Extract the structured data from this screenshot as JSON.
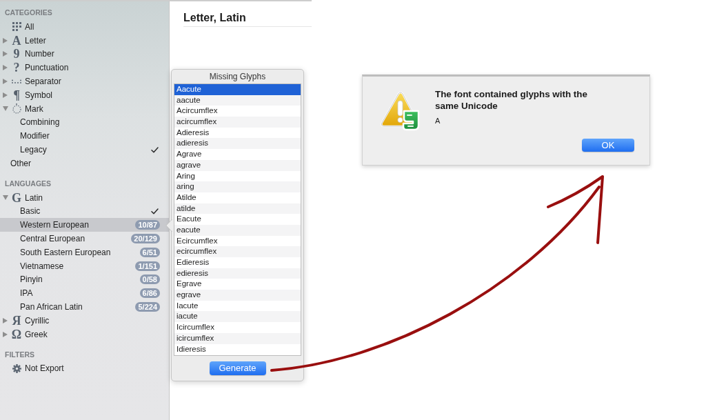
{
  "sidebar": {
    "sections": [
      {
        "title": "CATEGORIES",
        "items": [
          {
            "label": "All",
            "selected": false,
            "checked": false
          },
          {
            "label": "Letter",
            "glyph": "A",
            "expanded": false,
            "selected": false,
            "checked": false
          },
          {
            "label": "Number",
            "glyph": "9",
            "expanded": false,
            "selected": false,
            "checked": false
          },
          {
            "label": "Punctuation",
            "glyph": "?",
            "expanded": false,
            "selected": false,
            "checked": false
          },
          {
            "label": "Separator",
            "expanded": false,
            "selected": false,
            "checked": false
          },
          {
            "label": "Symbol",
            "glyph": "¶",
            "expanded": false,
            "selected": false,
            "checked": false
          },
          {
            "label": "Mark",
            "expanded": true,
            "selected": false,
            "checked": false,
            "children": [
              {
                "label": "Combining",
                "selected": false,
                "checked": false
              },
              {
                "label": "Modifier",
                "selected": false,
                "checked": false
              },
              {
                "label": "Legacy",
                "selected": false,
                "checked": true
              }
            ]
          },
          {
            "label": "Other",
            "selected": false,
            "checked": false
          }
        ]
      },
      {
        "title": "LANGUAGES",
        "items": [
          {
            "label": "Latin",
            "glyph": "G",
            "expanded": true,
            "selected": false,
            "checked": false,
            "children": [
              {
                "label": "Basic",
                "selected": false,
                "checked": true
              },
              {
                "label": "Western European",
                "badge": "10/87",
                "selected": true,
                "checked": false
              },
              {
                "label": "Central European",
                "badge": "20/129",
                "selected": false,
                "checked": false
              },
              {
                "label": "South Eastern European",
                "badge": "6/51",
                "selected": false,
                "checked": false
              },
              {
                "label": "Vietnamese",
                "badge": "1/151",
                "selected": false,
                "checked": false
              },
              {
                "label": "Pinyin",
                "badge": "0/58",
                "selected": false,
                "checked": false
              },
              {
                "label": "IPA",
                "badge": "6/86",
                "selected": false,
                "checked": false
              },
              {
                "label": "Pan African Latin",
                "badge": "5/224",
                "selected": false,
                "checked": false
              }
            ]
          },
          {
            "label": "Cyrillic",
            "glyph": "Я",
            "expanded": false,
            "selected": false,
            "checked": false
          },
          {
            "label": "Greek",
            "glyph": "Ω",
            "expanded": false,
            "selected": false,
            "checked": false
          }
        ]
      },
      {
        "title": "FILTERS",
        "items": [
          {
            "label": "Not Export",
            "selected": false,
            "checked": false
          }
        ]
      }
    ]
  },
  "main": {
    "heading": "Letter, Latin"
  },
  "popover": {
    "title": "Missing Glyphs",
    "glyphs": [
      {
        "name": "Aacute",
        "selected": true
      },
      {
        "name": "aacute",
        "selected": false
      },
      {
        "name": "Acircumflex",
        "selected": false
      },
      {
        "name": "acircumflex",
        "selected": false
      },
      {
        "name": "Adieresis",
        "selected": false
      },
      {
        "name": "adieresis",
        "selected": false
      },
      {
        "name": "Agrave",
        "selected": false
      },
      {
        "name": "agrave",
        "selected": false
      },
      {
        "name": "Aring",
        "selected": false
      },
      {
        "name": "aring",
        "selected": false
      },
      {
        "name": "Atilde",
        "selected": false
      },
      {
        "name": "atilde",
        "selected": false
      },
      {
        "name": "Eacute",
        "selected": false
      },
      {
        "name": "eacute",
        "selected": false
      },
      {
        "name": "Ecircumflex",
        "selected": false
      },
      {
        "name": "ecircumflex",
        "selected": false
      },
      {
        "name": "Edieresis",
        "selected": false
      },
      {
        "name": "edieresis",
        "selected": false
      },
      {
        "name": "Egrave",
        "selected": false
      },
      {
        "name": "egrave",
        "selected": false
      },
      {
        "name": "Iacute",
        "selected": false
      },
      {
        "name": "iacute",
        "selected": false
      },
      {
        "name": "Icircumflex",
        "selected": false
      },
      {
        "name": "icircumflex",
        "selected": false
      },
      {
        "name": "Idieresis",
        "selected": false
      }
    ],
    "button": "Generate"
  },
  "alert": {
    "message": "The font contained glyphs with the same Unicode",
    "detail": "A",
    "button": "OK"
  }
}
